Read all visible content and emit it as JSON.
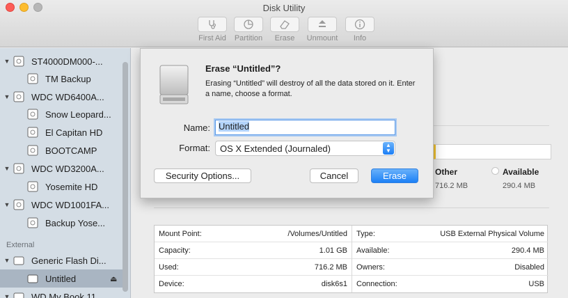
{
  "window": {
    "title": "Disk Utility"
  },
  "toolbar": [
    {
      "label": "First Aid",
      "icon": "stethoscope-icon"
    },
    {
      "label": "Partition",
      "icon": "partition-icon"
    },
    {
      "label": "Erase",
      "icon": "erase-icon"
    },
    {
      "label": "Unmount",
      "icon": "unmount-icon"
    },
    {
      "label": "Info",
      "icon": "info-icon"
    }
  ],
  "sidebar": {
    "items": [
      {
        "label": "ST4000DM000-..."
      },
      {
        "label": "TM Backup"
      },
      {
        "label": "WDC WD6400A..."
      },
      {
        "label": "Snow Leopard..."
      },
      {
        "label": "El Capitan HD"
      },
      {
        "label": "BOOTCAMP"
      },
      {
        "label": "WDC WD3200A..."
      },
      {
        "label": "Yosemite HD"
      },
      {
        "label": "WDC WD1001FA..."
      },
      {
        "label": "Backup Yose..."
      },
      {
        "label": "Generic Flash Di..."
      },
      {
        "label": "Untitled"
      },
      {
        "label": "WD My Book 11..."
      }
    ],
    "section_external": "External"
  },
  "usage": {
    "other_label": "Other",
    "other_value": "716.2 MB",
    "available_label": "Available",
    "available_value": "290.4 MB"
  },
  "info": {
    "left": [
      {
        "key": "Mount Point:",
        "value": "/Volumes/Untitled"
      },
      {
        "key": "Capacity:",
        "value": "1.01 GB"
      },
      {
        "key": "Used:",
        "value": "716.2 MB"
      },
      {
        "key": "Device:",
        "value": "disk6s1"
      }
    ],
    "right": [
      {
        "key": "Type:",
        "value": "USB External Physical Volume"
      },
      {
        "key": "Available:",
        "value": "290.4 MB"
      },
      {
        "key": "Owners:",
        "value": "Disabled"
      },
      {
        "key": "Connection:",
        "value": "USB"
      }
    ]
  },
  "dialog": {
    "title": "Erase “Untitled”?",
    "message": "Erasing “Untitled” will destroy of all the data stored on it. Enter a name, choose a format.",
    "name_label": "Name:",
    "name_value": "Untitled",
    "format_label": "Format:",
    "format_value": "OS X Extended (Journaled)",
    "security_button": "Security Options...",
    "cancel_button": "Cancel",
    "erase_button": "Erase"
  },
  "colors": {
    "accent": "#1c80f6",
    "sidebar_bg": "#d4dde5",
    "selection": "#a9b5c2"
  }
}
